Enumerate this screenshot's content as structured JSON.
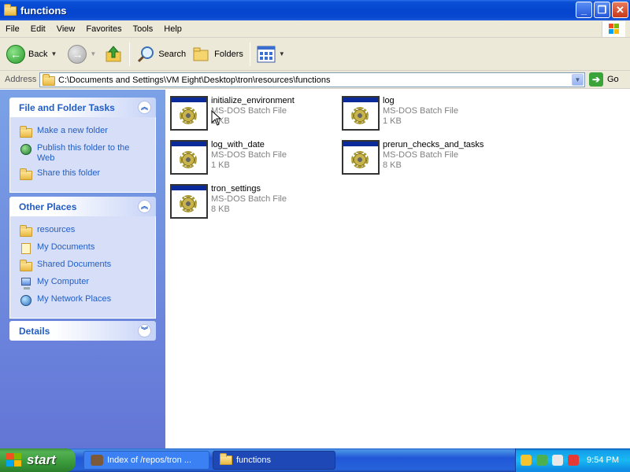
{
  "window": {
    "title": "functions"
  },
  "menu": [
    "File",
    "Edit",
    "View",
    "Favorites",
    "Tools",
    "Help"
  ],
  "toolbar": {
    "back": "Back",
    "search": "Search",
    "folders": "Folders"
  },
  "address": {
    "label": "Address",
    "path": "C:\\Documents and Settings\\VM Eight\\Desktop\\tron\\resources\\functions",
    "go": "Go"
  },
  "tasks_panel": {
    "title": "File and Folder Tasks",
    "items": [
      "Make a new folder",
      "Publish this folder to the Web",
      "Share this folder"
    ]
  },
  "places_panel": {
    "title": "Other Places",
    "items": [
      "resources",
      "My Documents",
      "Shared Documents",
      "My Computer",
      "My Network Places"
    ]
  },
  "details_panel": {
    "title": "Details"
  },
  "files": [
    {
      "name": "initialize_environment",
      "type": "MS-DOS Batch File",
      "size": "1 KB"
    },
    {
      "name": "log",
      "type": "MS-DOS Batch File",
      "size": "1 KB"
    },
    {
      "name": "log_with_date",
      "type": "MS-DOS Batch File",
      "size": "1 KB"
    },
    {
      "name": "prerun_checks_and_tasks",
      "type": "MS-DOS Batch File",
      "size": "8 KB"
    },
    {
      "name": "tron_settings",
      "type": "MS-DOS Batch File",
      "size": "8 KB"
    }
  ],
  "taskbar": {
    "start": "start",
    "tasks": [
      "Index of /repos/tron ...",
      "functions"
    ],
    "clock": "9:54 PM"
  },
  "icons": {
    "title": "folder-icon",
    "back": "back-arrow-icon",
    "forward": "forward-arrow-icon",
    "up": "up-folder-icon",
    "search": "magnifier-icon",
    "folders": "folders-icon",
    "views": "views-icon",
    "go": "go-arrow-icon"
  },
  "colors": {
    "title_bar": "#0646cf",
    "task_pane_link": "#215dc6",
    "taskbar": "#2157d7",
    "start": "#3a9a3a"
  }
}
